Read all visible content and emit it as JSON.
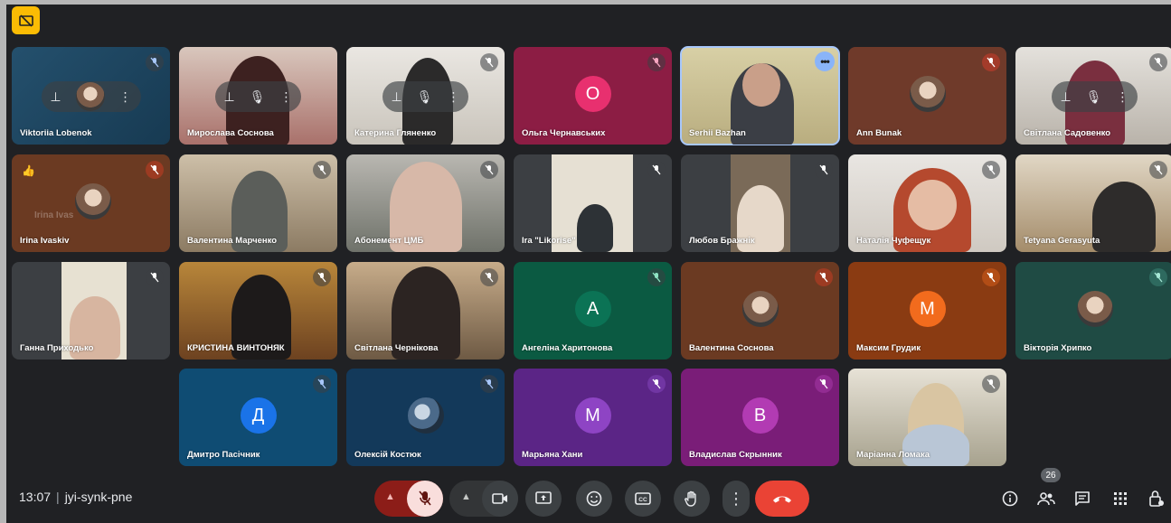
{
  "meeting": {
    "time": "13:07",
    "code": "jyi-synk-pne",
    "participant_count": "26"
  },
  "colors": {
    "end_call": "#ea4335",
    "mic_off_bg": "#f9dedc",
    "badge": "#fbbc04",
    "highlight": "#8ab4f8"
  },
  "tiles": [
    {
      "name": "Viktoriia Lobenok"
    },
    {
      "name": "Мирослава Соснова"
    },
    {
      "name": "Катерина Гляненко"
    },
    {
      "name": "Ольга Чернавських",
      "initial": "О"
    },
    {
      "name": "Serhii Bazhan"
    },
    {
      "name": "Ann Bunak"
    },
    {
      "name": "Світлана Садовенко"
    },
    {
      "name": "Irina Ivaskiv",
      "ghost": "Irina Ivas"
    },
    {
      "name": "Валентина Марченко"
    },
    {
      "name": "Абонемент ЦМБ"
    },
    {
      "name": "Ira \"Likorise\""
    },
    {
      "name": "Любов Бражнік"
    },
    {
      "name": "Наталія Чуфещук"
    },
    {
      "name": "Tetyana Gerasyuta"
    },
    {
      "name": "Ганна Приходько"
    },
    {
      "name": "КРИСТИНА ВИНТОНЯК"
    },
    {
      "name": "Світлана Чернікова"
    },
    {
      "name": "Ангеліна Харитонова",
      "initial": "A"
    },
    {
      "name": "Валентина Соснова"
    },
    {
      "name": "Максим Грудик",
      "initial": "M"
    },
    {
      "name": "Вікторія Хрипко"
    },
    {
      "name": "Дмитро Пасічник",
      "initial": "Д"
    },
    {
      "name": "Олексій Костюк"
    },
    {
      "name": "Марьяна Хани",
      "initial": "M"
    },
    {
      "name": "Владислав Скрынник",
      "initial": "B"
    },
    {
      "name": "Маріанна Ломака"
    }
  ],
  "icons": {
    "pin": "pin-icon",
    "mic_off": "mic-off-icon",
    "more": "more-vert-icon",
    "thumbs_up": "thumbs-up-icon"
  }
}
